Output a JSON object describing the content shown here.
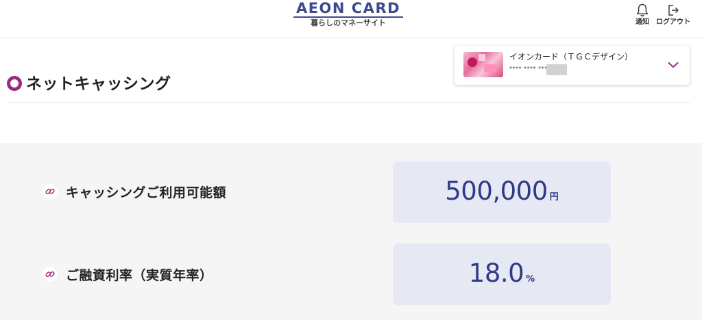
{
  "header": {
    "logo_main": "AEON CARD",
    "logo_sub": "暮らしのマネーサイト",
    "notify_label": "通知",
    "logout_label": "ログアウト"
  },
  "page": {
    "title": "ネットキャッシング"
  },
  "card_selector": {
    "card_name": "イオンカード（ＴＧＣデザイン）",
    "card_number_masked": "**** **** ****"
  },
  "info": {
    "rows": [
      {
        "label": "キャッシングご利用可能額",
        "value": "500,000",
        "unit": "円"
      },
      {
        "label": "ご融資利率（実質年率）",
        "value": "18.0",
        "unit": "%"
      }
    ]
  },
  "colors": {
    "brand_navy": "#3d4a8c",
    "accent_magenta": "#9c2a7f",
    "value_box_bg": "#e6e8f3",
    "value_text": "#2f3a86",
    "section_bg": "#f5f5f5"
  },
  "icons": {
    "notify": "bell-icon",
    "logout": "logout-icon",
    "title": "ring-icon",
    "row": "link-icon",
    "card_dropdown": "chevron-down-icon"
  }
}
